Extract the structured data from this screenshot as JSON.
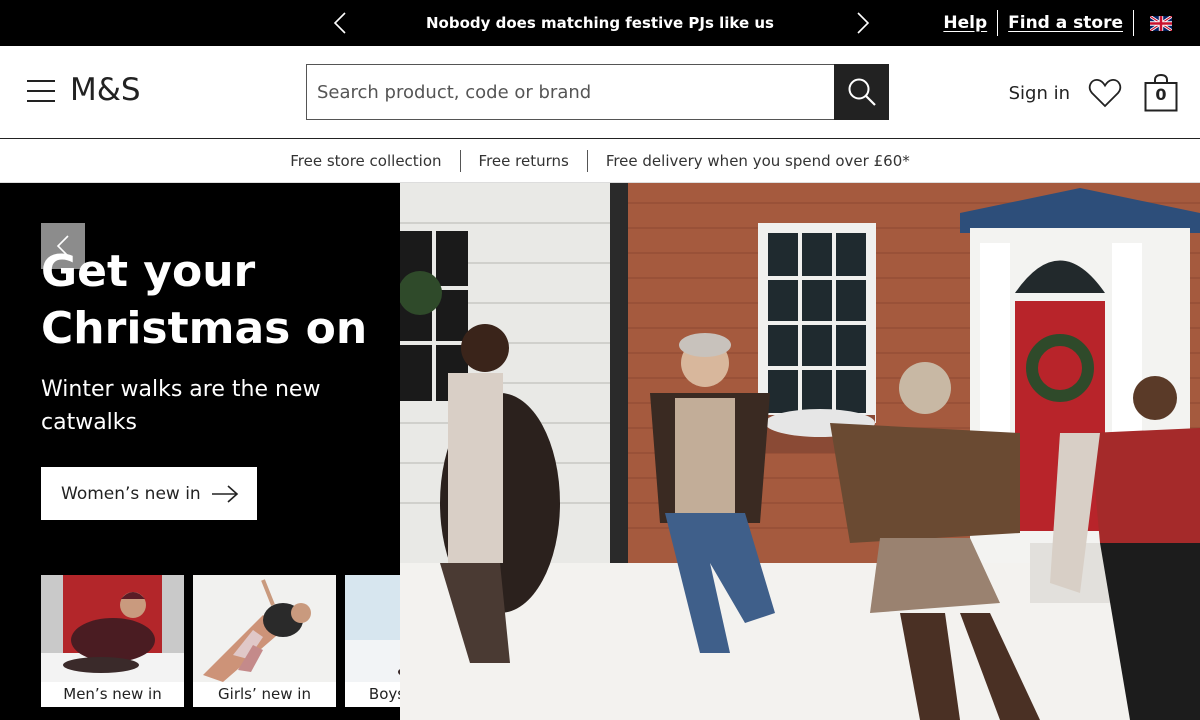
{
  "promo": {
    "message": "Nobody does matching festive PJs like us",
    "help_label": "Help",
    "store_label": "Find a store",
    "region_icon": "uk-flag-icon"
  },
  "header": {
    "logo": "M&S",
    "search_placeholder": "Search product, code or brand",
    "signin_label": "Sign in",
    "bag_count": "0"
  },
  "benefits": [
    "Free store collection",
    "Free returns",
    "Free delivery when you spend over £60*"
  ],
  "hero": {
    "title": "Get your Christmas on",
    "subtitle": "Winter walks are the new catwalks",
    "cta_label": "Women’s new in",
    "tiles": [
      {
        "label": "Men’s new in"
      },
      {
        "label": "Girls’ new in"
      },
      {
        "label": "Boys’ new in"
      }
    ]
  },
  "colors": {
    "black": "#000000",
    "dark": "#222222",
    "white": "#ffffff"
  }
}
